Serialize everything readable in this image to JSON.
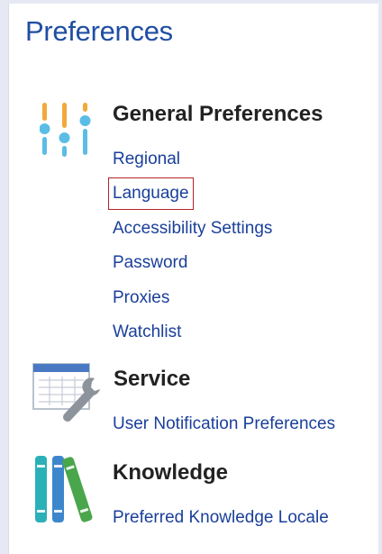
{
  "page": {
    "title": "Preferences"
  },
  "sections": {
    "general": {
      "heading": "General Preferences",
      "icon": "sliders-icon",
      "links": [
        "Regional",
        "Language",
        "Accessibility Settings",
        "Password",
        "Proxies",
        "Watchlist"
      ],
      "selected": "Language"
    },
    "service": {
      "heading": "Service",
      "icon": "wrench-spreadsheet-icon",
      "links": [
        "User Notification Preferences"
      ]
    },
    "knowledge": {
      "heading": "Knowledge",
      "icon": "books-icon",
      "links": [
        "Preferred Knowledge Locale"
      ]
    }
  },
  "colors": {
    "title": "#1f4ea3",
    "link": "#1a3f9a",
    "selection_border": "#b4232b",
    "slider_orange": "#f2a93b",
    "slider_blue": "#5bbde6"
  }
}
